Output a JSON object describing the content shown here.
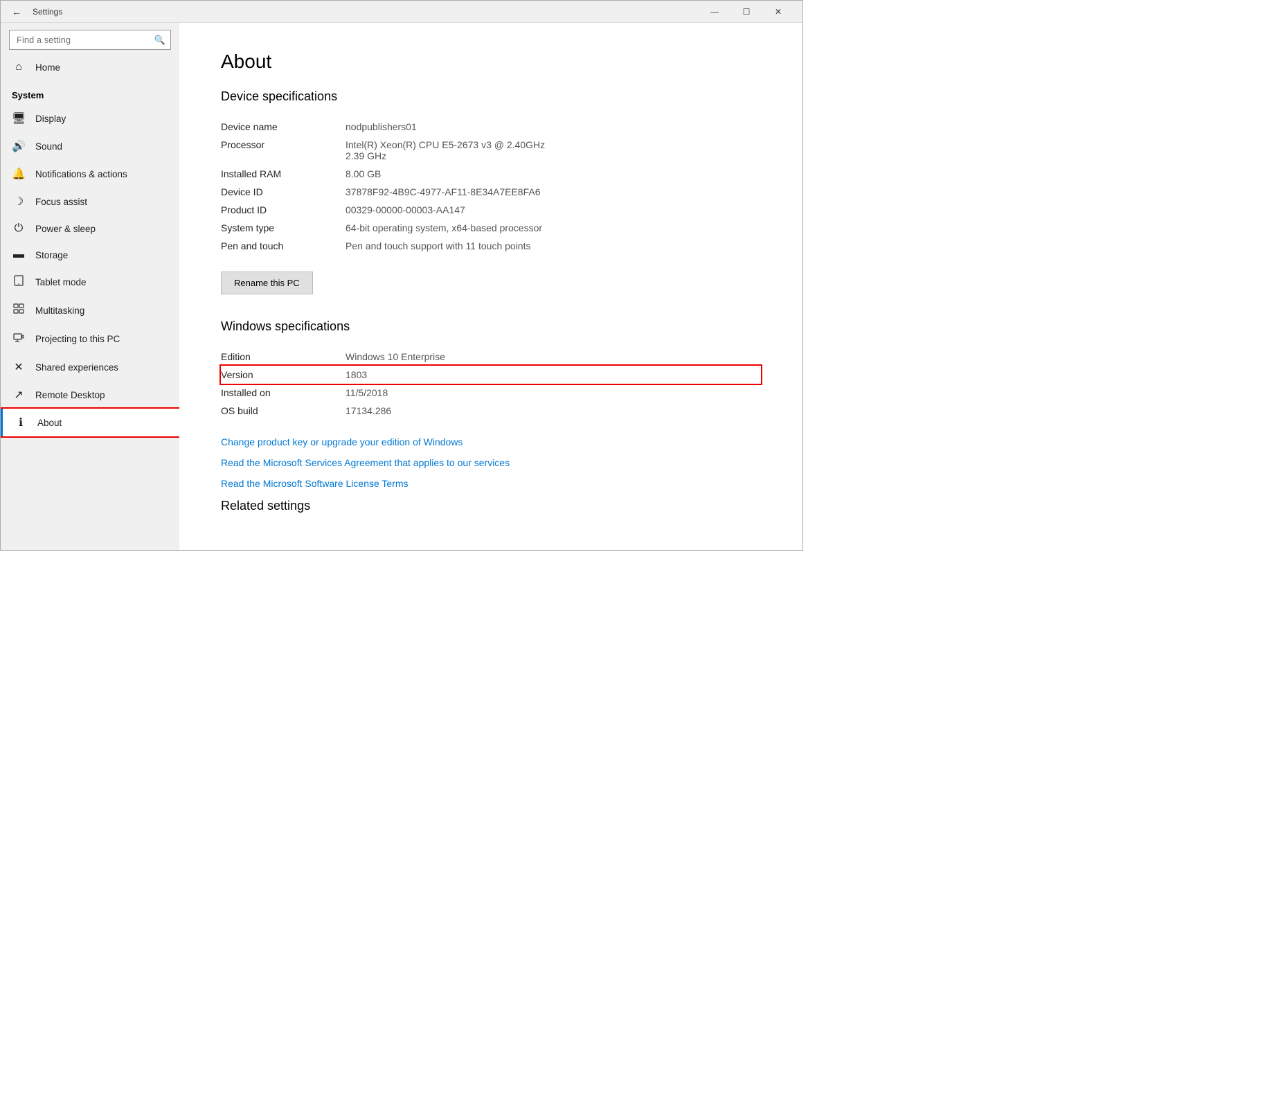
{
  "titlebar": {
    "title": "Settings",
    "back_label": "←",
    "minimize_label": "—",
    "maximize_label": "☐",
    "close_label": "✕"
  },
  "sidebar": {
    "search_placeholder": "Find a setting",
    "search_icon": "🔍",
    "category": "System",
    "items": [
      {
        "id": "home",
        "label": "Home",
        "icon": "⌂"
      },
      {
        "id": "display",
        "label": "Display",
        "icon": "🖥"
      },
      {
        "id": "sound",
        "label": "Sound",
        "icon": "🔊"
      },
      {
        "id": "notifications",
        "label": "Notifications & actions",
        "icon": "🔔"
      },
      {
        "id": "focus",
        "label": "Focus assist",
        "icon": "☽"
      },
      {
        "id": "power",
        "label": "Power & sleep",
        "icon": "⏻"
      },
      {
        "id": "storage",
        "label": "Storage",
        "icon": "💾"
      },
      {
        "id": "tablet",
        "label": "Tablet mode",
        "icon": "📱"
      },
      {
        "id": "multitasking",
        "label": "Multitasking",
        "icon": "⊟"
      },
      {
        "id": "projecting",
        "label": "Projecting to this PC",
        "icon": "⊞"
      },
      {
        "id": "shared",
        "label": "Shared experiences",
        "icon": "✕"
      },
      {
        "id": "remote",
        "label": "Remote Desktop",
        "icon": "↗"
      },
      {
        "id": "about",
        "label": "About",
        "icon": "ℹ"
      }
    ]
  },
  "content": {
    "title": "About",
    "device_specs_title": "Device specifications",
    "device_specs": [
      {
        "label": "Device name",
        "value": "nodpublishers01"
      },
      {
        "label": "Processor",
        "value": "Intel(R) Xeon(R) CPU E5-2673 v3 @ 2.40GHz\n2.39 GHz"
      },
      {
        "label": "Installed RAM",
        "value": "8.00 GB"
      },
      {
        "label": "Device ID",
        "value": "37878F92-4B9C-4977-AF11-8E34A7EE8FA6"
      },
      {
        "label": "Product ID",
        "value": "00329-00000-00003-AA147"
      },
      {
        "label": "System type",
        "value": "64-bit operating system, x64-based processor"
      },
      {
        "label": "Pen and touch",
        "value": "Pen and touch support with 11 touch points"
      }
    ],
    "rename_btn": "Rename this PC",
    "windows_specs_title": "Windows specifications",
    "windows_specs": [
      {
        "label": "Edition",
        "value": "Windows 10 Enterprise"
      },
      {
        "label": "Version",
        "value": "1803",
        "highlight": true
      },
      {
        "label": "Installed on",
        "value": "11/5/2018"
      },
      {
        "label": "OS build",
        "value": "17134.286"
      }
    ],
    "links": [
      "Change product key or upgrade your edition of Windows",
      "Read the Microsoft Services Agreement that applies to our services",
      "Read the Microsoft Software License Terms"
    ],
    "related_settings_title": "Related settings"
  }
}
